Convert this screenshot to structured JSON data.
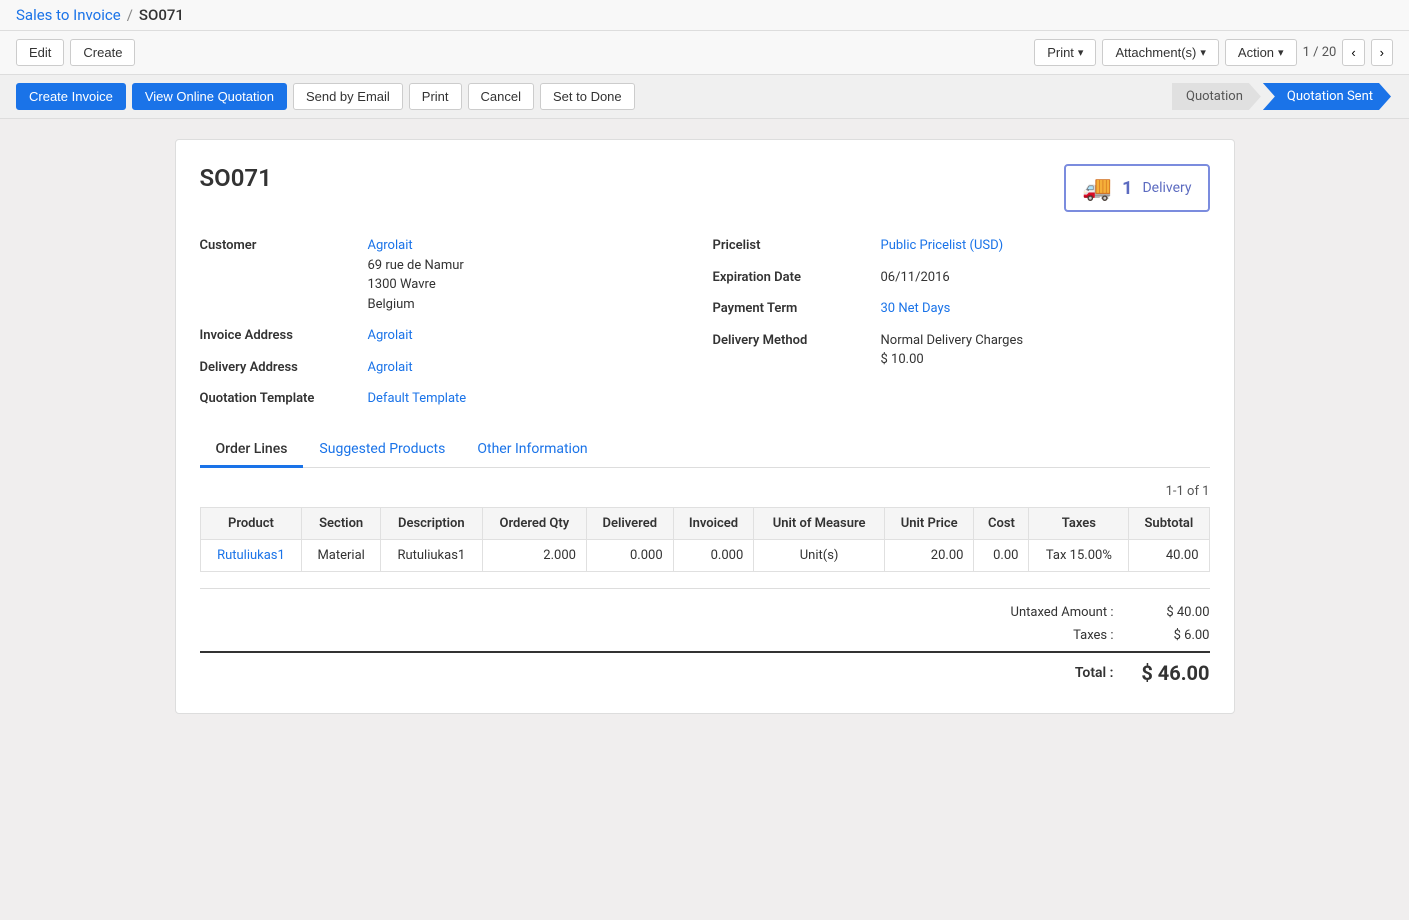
{
  "breadcrumb": {
    "parent_label": "Sales to Invoice",
    "separator": "/",
    "current": "SO071"
  },
  "toolbar": {
    "edit_label": "Edit",
    "create_label": "Create",
    "print_label": "Print",
    "attachments_label": "Attachment(s)",
    "action_label": "Action",
    "page_info": "1 / 20"
  },
  "action_bar": {
    "create_invoice_label": "Create Invoice",
    "view_online_label": "View Online Quotation",
    "send_email_label": "Send by Email",
    "print_label": "Print",
    "cancel_label": "Cancel",
    "set_done_label": "Set to Done"
  },
  "status_pipeline": {
    "steps": [
      {
        "label": "Quotation",
        "state": "done"
      },
      {
        "label": "Quotation Sent",
        "state": "active"
      }
    ]
  },
  "document": {
    "title": "SO071",
    "delivery_badge": {
      "count": "1",
      "label": "Delivery"
    },
    "customer": {
      "label": "Customer",
      "name": "Agrolait",
      "address_line1": "69 rue de Namur",
      "address_line2": "1300 Wavre",
      "address_line3": "Belgium"
    },
    "invoice_address": {
      "label": "Invoice Address",
      "value": "Agrolait"
    },
    "delivery_address": {
      "label": "Delivery Address",
      "value": "Agrolait"
    },
    "quotation_template": {
      "label": "Quotation Template",
      "value": "Default Template"
    },
    "pricelist": {
      "label": "Pricelist",
      "value": "Public Pricelist (USD)"
    },
    "expiration_date": {
      "label": "Expiration Date",
      "value": "06/11/2016"
    },
    "payment_term": {
      "label": "Payment Term",
      "value": "30 Net Days"
    },
    "delivery_method": {
      "label": "Delivery Method",
      "value": "Normal Delivery Charges",
      "extra": "$ 10.00"
    }
  },
  "tabs": [
    {
      "id": "order_lines",
      "label": "Order Lines",
      "active": true
    },
    {
      "id": "suggested_products",
      "label": "Suggested Products",
      "active": false
    },
    {
      "id": "other_info",
      "label": "Other Information",
      "active": false
    }
  ],
  "table": {
    "count_label": "1-1 of 1",
    "columns": [
      {
        "id": "product",
        "label": "Product"
      },
      {
        "id": "section",
        "label": "Section"
      },
      {
        "id": "description",
        "label": "Description"
      },
      {
        "id": "ordered_qty",
        "label": "Ordered Qty"
      },
      {
        "id": "delivered",
        "label": "Delivered"
      },
      {
        "id": "invoiced",
        "label": "Invoiced"
      },
      {
        "id": "unit_of_measure",
        "label": "Unit of Measure"
      },
      {
        "id": "unit_price",
        "label": "Unit Price"
      },
      {
        "id": "cost",
        "label": "Cost"
      },
      {
        "id": "taxes",
        "label": "Taxes"
      },
      {
        "id": "subtotal",
        "label": "Subtotal"
      }
    ],
    "rows": [
      {
        "product": "Rutuliukas1",
        "section": "Material",
        "description": "Rutuliukas1",
        "ordered_qty": "2.000",
        "delivered": "0.000",
        "invoiced": "0.000",
        "unit_of_measure": "Unit(s)",
        "unit_price": "20.00",
        "cost": "0.00",
        "taxes": "Tax 15.00%",
        "subtotal": "40.00"
      }
    ]
  },
  "totals": {
    "untaxed_label": "Untaxed Amount :",
    "untaxed_value": "$ 40.00",
    "taxes_label": "Taxes :",
    "taxes_value": "$ 6.00",
    "total_label": "Total :",
    "total_value": "$ 46.00"
  }
}
